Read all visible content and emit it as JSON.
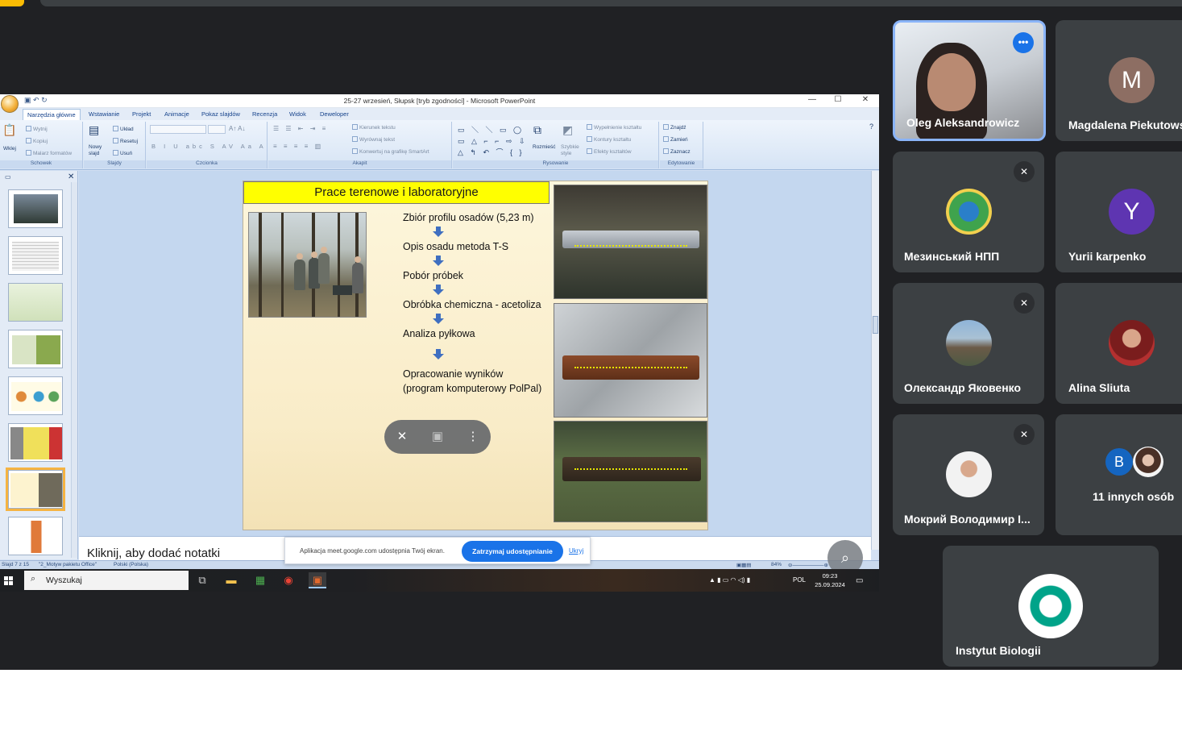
{
  "window": {
    "title": "25-27 wrzesień, Słupsk [tryb zgodności] - Microsoft PowerPoint",
    "controls": [
      "—",
      "☐",
      "✕"
    ]
  },
  "ribbon": {
    "tabs": [
      "Narzędzia główne",
      "Wstawianie",
      "Projekt",
      "Animacje",
      "Pokaz slajdów",
      "Recenzja",
      "Widok",
      "Deweloper"
    ],
    "groups": {
      "clipboard": {
        "label": "Schowek",
        "paste": "Wklej",
        "cut": "Wytnij",
        "copy": "Kopiuj",
        "format": "Malarz formatów"
      },
      "slides": {
        "label": "Slajdy",
        "new": "Nowy slajd",
        "layout": "Układ",
        "reset": "Resetuj",
        "delete": "Usuń"
      },
      "font": {
        "label": "Czcionka"
      },
      "paragraph": {
        "label": "Akapit",
        "direction": "Kierunek tekstu",
        "align": "Wyrównaj tekst",
        "smartart": "Konwertuj na grafikę SmartArt"
      },
      "drawing": {
        "label": "Rysowanie",
        "arrange": "Rozmieść",
        "styles": "Szybkie style",
        "fill": "Wypełnienie kształtu",
        "outline": "Kontury kształtu",
        "effects": "Efekty kształtów"
      },
      "editing": {
        "label": "Edytowanie",
        "find": "Znajdź",
        "replace": "Zamień",
        "select": "Zaznacz"
      }
    }
  },
  "slide": {
    "title": "Prace terenowe i laboratoryjne",
    "steps": [
      "Zbiór profilu osadów  (5,23 m)",
      "Opis osadu metoda T-S",
      "Pobór próbek",
      "Obróbka chemiczna - acetoliza",
      "Analiza pyłkowa",
      "Opracowanie wyników",
      "(program komputerowy PolPal)"
    ]
  },
  "thumbnails": [
    "1",
    "2",
    "3",
    "4",
    "5",
    "6",
    "7",
    "8"
  ],
  "notes_placeholder": "Kliknij, aby dodać notatki",
  "statusbar": {
    "slide": "Slajd 7 z 15",
    "theme": "\"2_Motyw pakietu Office\"",
    "language": "Polski (Polska)",
    "zoom": "84%"
  },
  "share_banner": {
    "message": "Aplikacja meet.google.com udostępnia Twój ekran.",
    "stop": "Zatrzymaj udostępnianie",
    "hide": "Ukryj"
  },
  "taskbar": {
    "search": "Wyszukaj",
    "lang": "POL",
    "time": "09:23",
    "date": "25.09.2024"
  },
  "participants": [
    {
      "name": "Oleg Aleksandrowicz",
      "initial": "",
      "speaking": true
    },
    {
      "name": "Magdalena Piekutows",
      "initial": "M",
      "color": "#8d6e63"
    },
    {
      "name": "Мезинський НПП",
      "initial": "",
      "muted": true
    },
    {
      "name": "Yurii karpenko",
      "initial": "Y",
      "color": "#5e35b1"
    },
    {
      "name": "Олександр Яковенко",
      "initial": "",
      "muted": true
    },
    {
      "name": "Alina Sliuta",
      "initial": ""
    },
    {
      "name": "Мокрий Володимир І...",
      "initial": "",
      "muted": true
    },
    {
      "name": "11 innych osób",
      "initial": "B",
      "color": "#1565c0"
    },
    {
      "name": "Instytut Biologii",
      "initial": "",
      "color": "#00a389"
    }
  ],
  "colors": {
    "meet_bg": "#202124",
    "tile_bg": "#3c4043",
    "accent": "#1a73e8",
    "slide_title_bg": "#ffff00"
  }
}
